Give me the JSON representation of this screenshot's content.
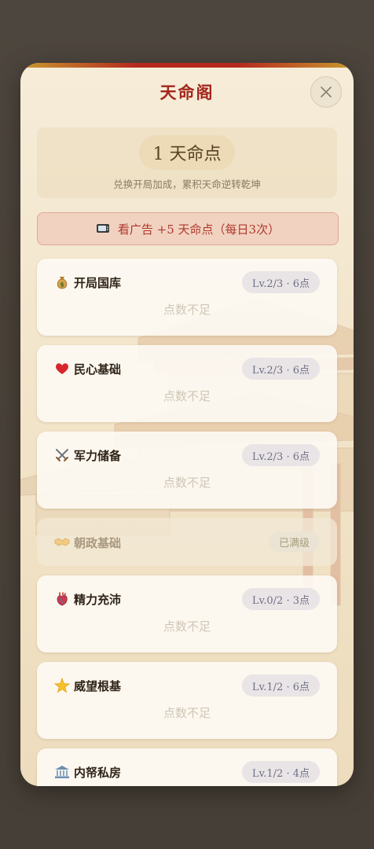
{
  "dialog": {
    "title": "天命阁",
    "points_display": "1 天命点",
    "subtitle": "兑换开局加成，累积天命逆转乾坤",
    "ad_button_label": "看广告 +5 天命点（每日3次）"
  },
  "perks": [
    {
      "name": "开局国库",
      "icon": "money-bag-icon",
      "level": "Lv.2/3 · 6点",
      "status": "点数不足",
      "maxed": false
    },
    {
      "name": "民心基础",
      "icon": "heart-icon",
      "level": "Lv.2/3 · 6点",
      "status": "点数不足",
      "maxed": false
    },
    {
      "name": "军力储备",
      "icon": "crossed-swords-icon",
      "level": "Lv.2/3 · 6点",
      "status": "点数不足",
      "maxed": false
    },
    {
      "name": "朝政基础",
      "icon": "handshake-icon",
      "level": "已满级",
      "status": "",
      "maxed": true
    },
    {
      "name": "精力充沛",
      "icon": "anatomical-heart-icon",
      "level": "Lv.0/2 · 3点",
      "status": "点数不足",
      "maxed": false
    },
    {
      "name": "威望根基",
      "icon": "glowing-star-icon",
      "level": "Lv.1/2 · 6点",
      "status": "点数不足",
      "maxed": false
    },
    {
      "name": "内帑私房",
      "icon": "bank-icon",
      "level": "Lv.1/2 · 4点",
      "status": "",
      "maxed": false
    }
  ],
  "colors": {
    "accent_red": "#a3271d",
    "card_bg": "#fdfaf4",
    "badge_bg": "#e9e5e6"
  }
}
